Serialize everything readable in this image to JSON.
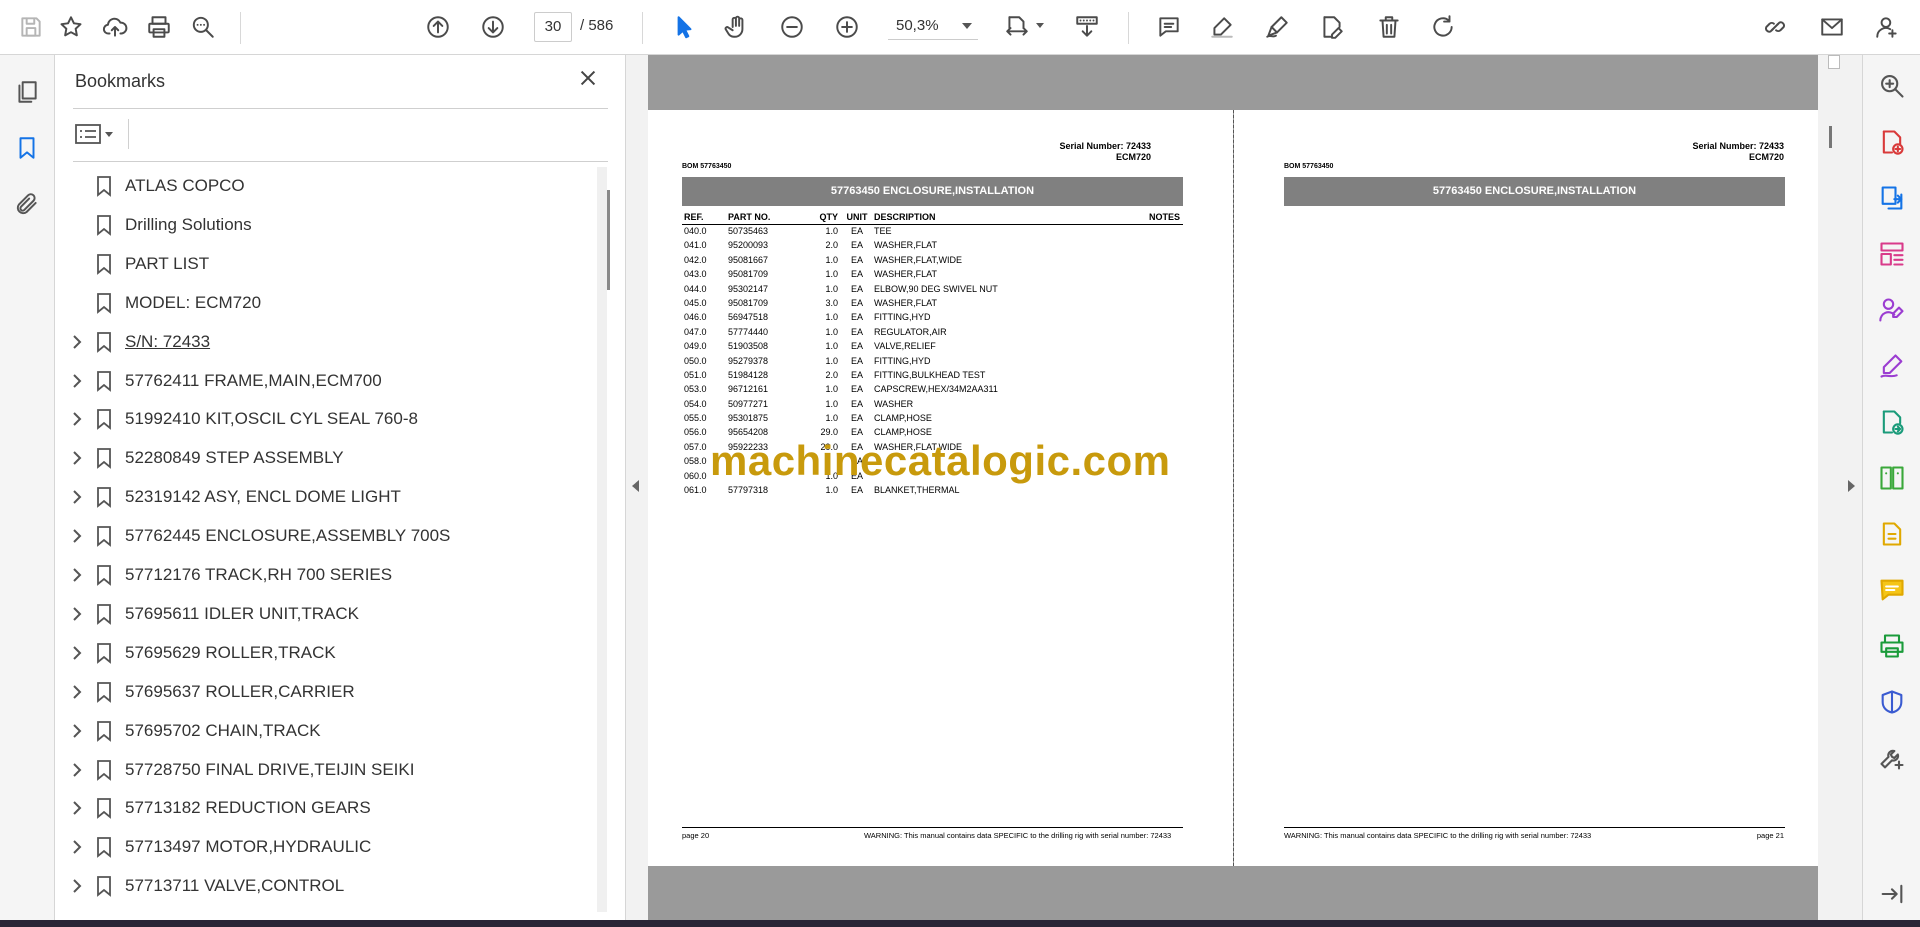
{
  "toolbar": {
    "current_page": "30",
    "page_total": "/  586",
    "zoom": "50,3%"
  },
  "panel": {
    "title": "Bookmarks"
  },
  "bookmarks": [
    {
      "label": "ATLAS COPCO",
      "expandable": false,
      "linked": false
    },
    {
      "label": "Drilling Solutions",
      "expandable": false,
      "linked": false
    },
    {
      "label": "PART LIST",
      "expandable": false,
      "linked": false
    },
    {
      "label": "MODEL: ECM720",
      "expandable": false,
      "linked": false
    },
    {
      "label": "S/N: 72433",
      "expandable": true,
      "linked": true
    },
    {
      "label": "57762411 FRAME,MAIN,ECM700",
      "expandable": true,
      "linked": false
    },
    {
      "label": "51992410 KIT,OSCIL CYL SEAL 760-8",
      "expandable": true,
      "linked": false
    },
    {
      "label": "52280849 STEP ASSEMBLY",
      "expandable": true,
      "linked": false
    },
    {
      "label": "52319142 ASY, ENCL DOME LIGHT",
      "expandable": true,
      "linked": false
    },
    {
      "label": "57762445 ENCLOSURE,ASSEMBLY 700S",
      "expandable": true,
      "linked": false
    },
    {
      "label": "57712176 TRACK,RH 700 SERIES",
      "expandable": true,
      "linked": false
    },
    {
      "label": "57695611 IDLER UNIT,TRACK",
      "expandable": true,
      "linked": false
    },
    {
      "label": "57695629 ROLLER,TRACK",
      "expandable": true,
      "linked": false
    },
    {
      "label": "57695637 ROLLER,CARRIER",
      "expandable": true,
      "linked": false
    },
    {
      "label": "57695702 CHAIN,TRACK",
      "expandable": true,
      "linked": false
    },
    {
      "label": "57728750 FINAL DRIVE,TEIJIN SEIKI",
      "expandable": true,
      "linked": false
    },
    {
      "label": "57713182 REDUCTION GEARS",
      "expandable": true,
      "linked": false
    },
    {
      "label": "57713497 MOTOR,HYDRAULIC",
      "expandable": true,
      "linked": false
    },
    {
      "label": "57713711 VALVE,CONTROL",
      "expandable": true,
      "linked": false
    }
  ],
  "left_page": {
    "serial": "Serial Number: 72433",
    "model": "ECM720",
    "bom": "BOM 57763450",
    "banner": "57763450 ENCLOSURE,INSTALLATION",
    "headers": {
      "ref": "REF.",
      "part": "PART NO.",
      "qty": "QTY",
      "unit": "UNIT",
      "desc": "DESCRIPTION",
      "notes": "NOTES"
    },
    "rows": [
      {
        "ref": "040.0",
        "part": "50735463",
        "qty": "1.0",
        "unit": "EA",
        "desc": "TEE"
      },
      {
        "ref": "041.0",
        "part": "95200093",
        "qty": "2.0",
        "unit": "EA",
        "desc": "WASHER,FLAT"
      },
      {
        "ref": "042.0",
        "part": "95081667",
        "qty": "1.0",
        "unit": "EA",
        "desc": "WASHER,FLAT,WIDE"
      },
      {
        "ref": "043.0",
        "part": "95081709",
        "qty": "1.0",
        "unit": "EA",
        "desc": "WASHER,FLAT"
      },
      {
        "ref": "044.0",
        "part": "95302147",
        "qty": "1.0",
        "unit": "EA",
        "desc": "ELBOW,90 DEG SWIVEL NUT"
      },
      {
        "ref": "045.0",
        "part": "95081709",
        "qty": "3.0",
        "unit": "EA",
        "desc": "WASHER,FLAT"
      },
      {
        "ref": "046.0",
        "part": "56947518",
        "qty": "1.0",
        "unit": "EA",
        "desc": "FITTING,HYD"
      },
      {
        "ref": "047.0",
        "part": "57774440",
        "qty": "1.0",
        "unit": "EA",
        "desc": "REGULATOR,AIR"
      },
      {
        "ref": "049.0",
        "part": "51903508",
        "qty": "1.0",
        "unit": "EA",
        "desc": "VALVE,RELIEF"
      },
      {
        "ref": "050.0",
        "part": "95279378",
        "qty": "1.0",
        "unit": "EA",
        "desc": "FITTING,HYD"
      },
      {
        "ref": "051.0",
        "part": "51984128",
        "qty": "2.0",
        "unit": "EA",
        "desc": "FITTING,BULKHEAD TEST"
      },
      {
        "ref": "053.0",
        "part": "96712161",
        "qty": "1.0",
        "unit": "EA",
        "desc": "CAPSCREW,HEX/34M2AA311"
      },
      {
        "ref": "054.0",
        "part": "50977271",
        "qty": "1.0",
        "unit": "EA",
        "desc": "WASHER"
      },
      {
        "ref": "055.0",
        "part": "95301875",
        "qty": "1.0",
        "unit": "EA",
        "desc": "CLAMP,HOSE"
      },
      {
        "ref": "056.0",
        "part": "95654208",
        "qty": "29.0",
        "unit": "EA",
        "desc": "CLAMP,HOSE"
      },
      {
        "ref": "057.0",
        "part": "95922233",
        "qty": "29.0",
        "unit": "EA",
        "desc": "WASHER,FLAT,WIDE"
      },
      {
        "ref": "058.0",
        "part": "",
        "qty": "",
        "unit": "EA",
        "desc": ""
      },
      {
        "ref": "060.0",
        "part": "",
        "qty": "1.0",
        "unit": "EA",
        "desc": ""
      },
      {
        "ref": "061.0",
        "part": "57797318",
        "qty": "1.0",
        "unit": "EA",
        "desc": "BLANKET,THERMAL"
      }
    ],
    "footer_page": "page 20",
    "footer_warning": "WARNING:  This manual contains data SPECIFIC to the drilling rig with serial number: 72433"
  },
  "right_page": {
    "serial": "Serial Number: 72433",
    "model": "ECM720",
    "bom": "BOM 57763450",
    "banner": "57763450 ENCLOSURE,INSTALLATION",
    "footer_page": "page 21",
    "footer_warning": "WARNING:  This manual contains data SPECIFIC to the drilling rig with serial number: 72433"
  },
  "watermark": "machinecatalogic.com",
  "colors": {
    "accent_blue": "#1473e6",
    "watermark": "#c89a0c",
    "banner_gray": "#808080",
    "doc_background": "#9a9a9a"
  },
  "icons": {
    "toolbar": [
      "save-icon",
      "star-icon",
      "upload-cloud-icon",
      "print-icon",
      "find-icon",
      "page-up-icon",
      "page-down-icon",
      "select-cursor-icon",
      "hand-icon",
      "zoom-out-icon",
      "zoom-in-icon",
      "page-fit-icon",
      "scroll-mode-icon",
      "comment-icon",
      "highlight-icon",
      "sign-icon",
      "edit-text-icon",
      "delete-icon",
      "rotate-icon",
      "share-link-icon",
      "mail-icon",
      "account-icon"
    ],
    "left_rail": [
      "pages-icon",
      "bookmark-icon",
      "attachment-icon"
    ],
    "right_rail": [
      "search-zoom-icon",
      "create-pdf-icon",
      "export-pdf-icon",
      "organize-pages-icon",
      "request-sign-icon",
      "fill-sign-icon",
      "send-review-icon",
      "compare-icon",
      "scan-icon",
      "comment-tool-icon",
      "print-production-icon",
      "protect-icon",
      "more-tools-icon",
      "collapse-panel-icon"
    ]
  }
}
